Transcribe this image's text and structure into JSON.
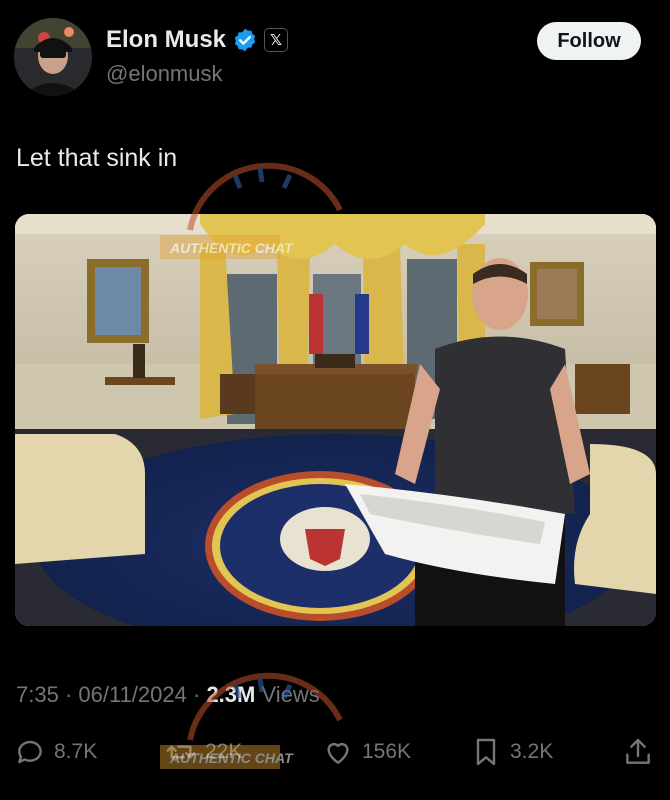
{
  "author": {
    "name": "Elon Musk",
    "handle": "@elonmusk",
    "verified_icon": "verified-badge-icon",
    "affiliate_icon": "x-logo-icon",
    "affiliate_glyph": "𝕏"
  },
  "follow_label": "Follow",
  "tweet_text": "Let that sink in",
  "meta": {
    "time": "7:35",
    "separator1": " · ",
    "date": "06/11/2024",
    "separator2": " · ",
    "views_count": "2.3M",
    "views_label": " Views"
  },
  "actions": {
    "reply": "8.7K",
    "repost": "22K",
    "like": "156K",
    "bookmark": "3.2K"
  },
  "watermark": {
    "text": "AUTHENTIC CHAT"
  },
  "colors": {
    "background": "#000000",
    "text": "#e7e9ea",
    "muted": "#71767b",
    "verified": "#1d9bf0",
    "follow_bg": "#eff3f4"
  }
}
